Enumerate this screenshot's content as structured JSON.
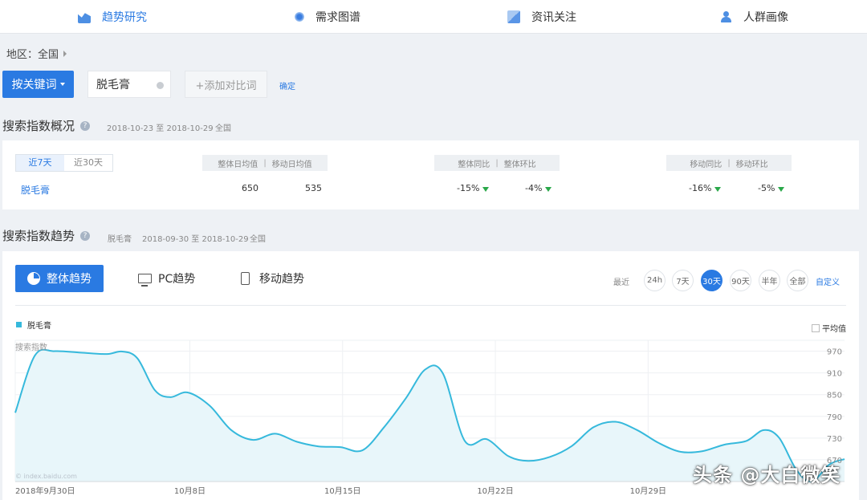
{
  "nav": {
    "items": [
      {
        "label": "趋势研究",
        "icon": "trend-icon",
        "active": true
      },
      {
        "label": "需求图谱",
        "icon": "demand-icon",
        "active": false
      },
      {
        "label": "资讯关注",
        "icon": "news-icon",
        "active": false
      },
      {
        "label": "人群画像",
        "icon": "people-icon",
        "active": false
      }
    ]
  },
  "region": {
    "label": "地区：全国"
  },
  "keyword": {
    "mode_button": "按关键词",
    "value": "脱毛膏",
    "add_compare": "+添加对比词",
    "confirm": "确定"
  },
  "overview": {
    "title": "搜索指数概况",
    "date_range": "2018-10-23 至 2018-10-29",
    "region": "全国",
    "seg": [
      "近7天",
      "近30天"
    ],
    "header_avg": [
      "整体日均值",
      "移动日均值"
    ],
    "header_yoy": [
      "整体同比",
      "整体环比"
    ],
    "header_mob": [
      "移动同比",
      "移动环比"
    ],
    "keyword": "脱毛膏",
    "avg_overall": "650",
    "avg_mobile": "535",
    "yoy_overall": "-15%",
    "mom_overall": "-4%",
    "yoy_mobile": "-16%",
    "mom_mobile": "-5%",
    "trend_color": "#2aa84a"
  },
  "trend": {
    "title": "搜索指数趋势",
    "keyword": "脱毛膏",
    "date_range": "2018-09-30 至 2018-10-29",
    "region": "全国",
    "tabs": [
      "整体趋势",
      "PC趋势",
      "移动趋势"
    ],
    "range_label": "最近",
    "ranges": [
      "24h",
      "7天",
      "30天",
      "90天",
      "半年",
      "全部"
    ],
    "active_range": "30天",
    "custom": "自定义",
    "legend": "脱毛膏",
    "avg_checkbox": "平均值"
  },
  "chart_data": {
    "type": "area",
    "ylabel": "搜索指数",
    "watermark": "© index.baidu.com",
    "y_ticks": [
      670,
      730,
      790,
      850,
      910,
      970
    ],
    "ylim": [
      610,
      1000
    ],
    "x_tick_labels": [
      "2018年9月30日",
      "10月8日",
      "10月15日",
      "10月22日",
      "10月29日"
    ],
    "x_tick_days": [
      0,
      8,
      15,
      22,
      29
    ],
    "series": [
      {
        "name": "脱毛膏",
        "color": "#36b9dc",
        "points": [
          {
            "d": 0,
            "v": 800
          },
          {
            "d": 0.9,
            "v": 958
          },
          {
            "d": 1.8,
            "v": 970
          },
          {
            "d": 3,
            "v": 966
          },
          {
            "d": 4.2,
            "v": 962
          },
          {
            "d": 4.9,
            "v": 969
          },
          {
            "d": 5.6,
            "v": 950
          },
          {
            "d": 6.4,
            "v": 862
          },
          {
            "d": 7.1,
            "v": 843
          },
          {
            "d": 7.9,
            "v": 856
          },
          {
            "d": 8.9,
            "v": 820
          },
          {
            "d": 9.9,
            "v": 752
          },
          {
            "d": 10.9,
            "v": 725
          },
          {
            "d": 11.9,
            "v": 742
          },
          {
            "d": 12.9,
            "v": 720
          },
          {
            "d": 13.9,
            "v": 707
          },
          {
            "d": 14.9,
            "v": 705
          },
          {
            "d": 15.9,
            "v": 696
          },
          {
            "d": 16.9,
            "v": 760
          },
          {
            "d": 17.9,
            "v": 840
          },
          {
            "d": 18.8,
            "v": 920
          },
          {
            "d": 19.6,
            "v": 908
          },
          {
            "d": 20.6,
            "v": 722
          },
          {
            "d": 21.6,
            "v": 727
          },
          {
            "d": 22.6,
            "v": 680
          },
          {
            "d": 23.5,
            "v": 667
          },
          {
            "d": 24.5,
            "v": 678
          },
          {
            "d": 25.5,
            "v": 708
          },
          {
            "d": 26.5,
            "v": 760
          },
          {
            "d": 27.5,
            "v": 775
          },
          {
            "d": 28.5,
            "v": 752
          },
          {
            "d": 29.5,
            "v": 716
          },
          {
            "d": 30.5,
            "v": 692
          },
          {
            "d": 31.5,
            "v": 694
          },
          {
            "d": 32.5,
            "v": 712
          },
          {
            "d": 33.5,
            "v": 722
          },
          {
            "d": 34.3,
            "v": 752
          },
          {
            "d": 35,
            "v": 731
          },
          {
            "d": 35.8,
            "v": 642
          },
          {
            "d": 36.5,
            "v": 610
          },
          {
            "d": 37.3,
            "v": 657
          },
          {
            "d": 38,
            "v": 672
          }
        ]
      }
    ]
  },
  "watermark_br": "头条 @大白微笑"
}
